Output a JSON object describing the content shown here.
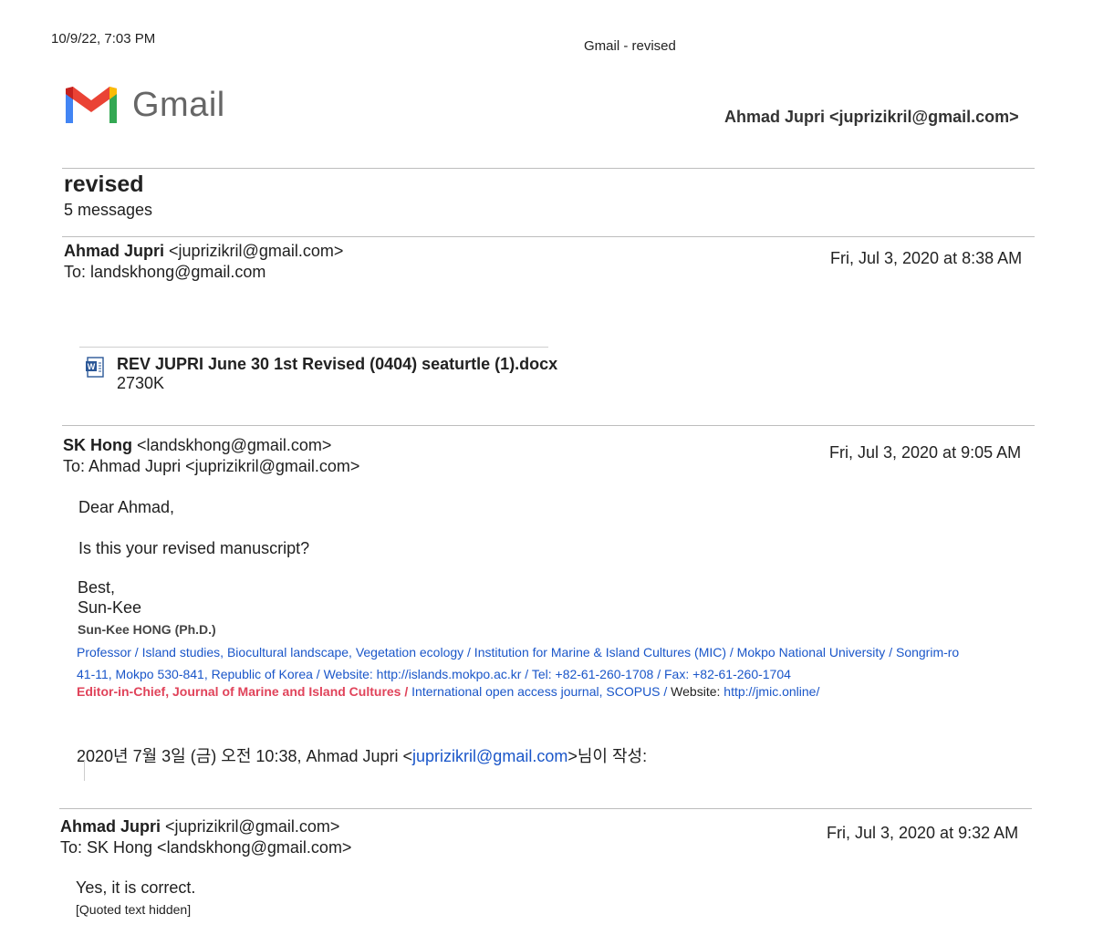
{
  "print_header": {
    "datetime": "10/9/22, 7:03 PM",
    "page_title": "Gmail - revised"
  },
  "brand": {
    "logo_text": "Gmail",
    "colors": {
      "blue": "#4285F4",
      "red": "#EA4335",
      "yellow": "#FBBC04",
      "green": "#34A853"
    }
  },
  "account": {
    "label": "Ahmad Jupri <juprizikril@gmail.com>"
  },
  "thread": {
    "subject": "revised",
    "count": "5 messages"
  },
  "messages": [
    {
      "sender_name": "Ahmad Jupri",
      "sender_email": "<juprizikril@gmail.com>",
      "to": "To: landskhong@gmail.com",
      "date": "Fri, Jul 3, 2020 at 8:38 AM",
      "attachment": {
        "icon": "word-doc-icon",
        "name": "REV JUPRI June 30 1st Revised (0404) seaturtle (1).docx",
        "size": "2730K"
      }
    },
    {
      "sender_name": "SK Hong",
      "sender_email": "<landskhong@gmail.com>",
      "to": "To: Ahmad Jupri <juprizikril@gmail.com>",
      "date": "Fri, Jul 3, 2020 at 9:05 AM",
      "greeting": "Dear Ahmad,",
      "body": "Is this your revised manuscript?",
      "closing": "Best,",
      "closing_name": "Sun-Kee",
      "signature": {
        "name": "Sun-Kee HONG (Ph.D.)",
        "line1": "Professor / Island studies, Biocultural landscape, Vegetation ecology / Institution for Marine & Island Cultures (MIC) / Mokpo National University / Songrim-ro",
        "line2_prefix": "41-11, Mokpo 530-841, Republic of Korea / Website: ",
        "line2_link": "http://islands.mokpo.ac.kr",
        "line2_sep": " / Tel: +82-61-260-1708 / Fax: +82-61-260-1704",
        "line3_editor": "Editor-in-Chief, Journal of Marine and Island Cultures /",
        "line3_journal": " International open access journal, SCOPUS /",
        "line3_website_label": " Website: ",
        "line3_link": "http://jmic.online/"
      },
      "quote_intro_prefix": "2020년 7월 3일 (금) 오전 10:38, Ahmad Jupri <",
      "quote_intro_email": "juprizikril@gmail.com",
      "quote_intro_suffix": ">님이 작성:"
    },
    {
      "sender_name": "Ahmad Jupri",
      "sender_email": "<juprizikril@gmail.com>",
      "to": "To: SK Hong <landskhong@gmail.com>",
      "date": "Fri, Jul 3, 2020 at 9:32 AM",
      "body": "Yes, it is correct.",
      "quoted": "[Quoted text hidden]"
    }
  ]
}
